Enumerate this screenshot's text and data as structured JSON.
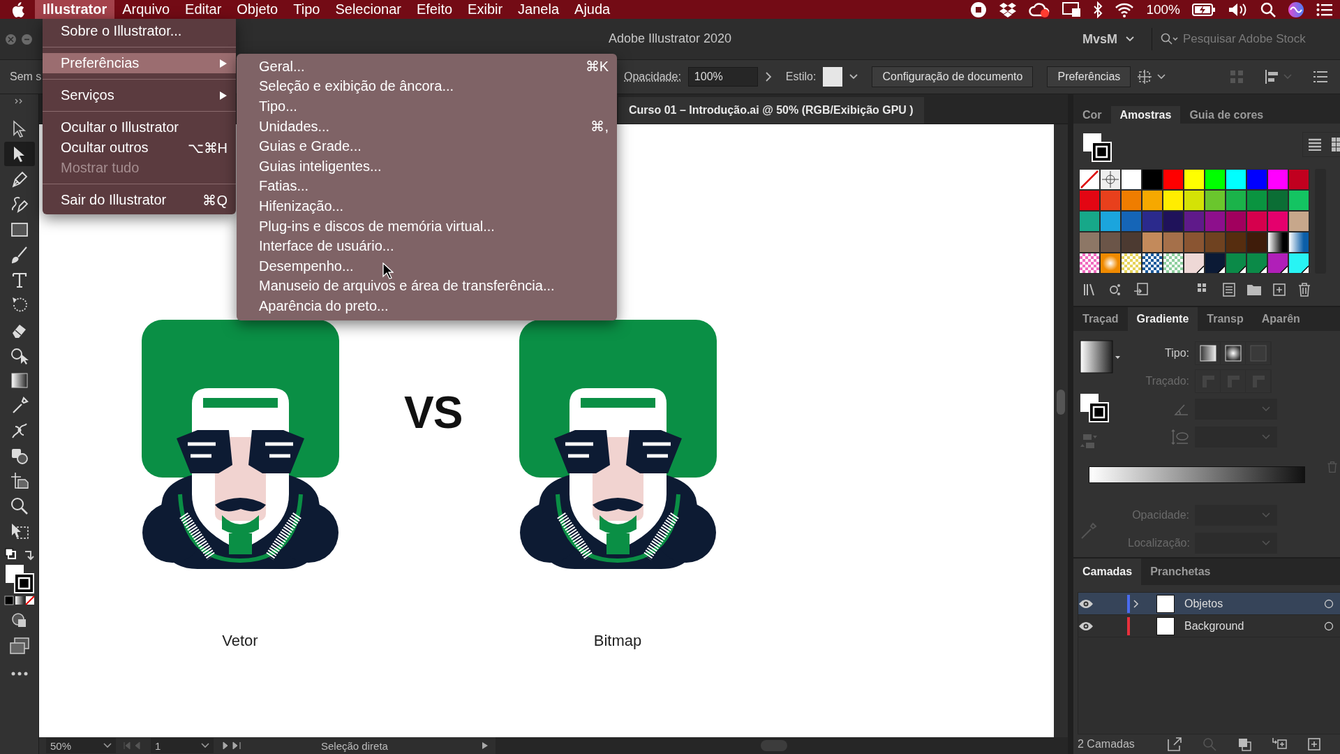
{
  "menubar": {
    "menus": [
      {
        "label": "Illustrator",
        "selected": true
      },
      {
        "label": "Arquivo",
        "selected": false
      },
      {
        "label": "Editar",
        "selected": false
      },
      {
        "label": "Objeto",
        "selected": false
      },
      {
        "label": "Tipo",
        "selected": false
      },
      {
        "label": "Selecionar",
        "selected": false
      },
      {
        "label": "Efeito",
        "selected": false
      },
      {
        "label": "Exibir",
        "selected": false
      },
      {
        "label": "Janela",
        "selected": false
      },
      {
        "label": "Ajuda",
        "selected": false
      }
    ],
    "battery": "100%"
  },
  "app_menu": {
    "groups": [
      [
        {
          "label": "Sobre o Illustrator...",
          "selected": false,
          "disabled": false,
          "submenu": false
        }
      ],
      [
        {
          "label": "Preferências",
          "selected": true,
          "disabled": false,
          "submenu": true
        }
      ],
      [
        {
          "label": "Serviços",
          "selected": false,
          "disabled": false,
          "submenu": true
        }
      ],
      [
        {
          "label": "Ocultar o Illustrator",
          "selected": false,
          "disabled": false,
          "submenu": false
        },
        {
          "label": "Ocultar outros",
          "shortcut": "⌥⌘H",
          "selected": false,
          "disabled": false,
          "submenu": false
        },
        {
          "label": "Mostrar tudo",
          "selected": false,
          "disabled": true,
          "submenu": false
        }
      ],
      [
        {
          "label": "Sair do Illustrator",
          "shortcut": "⌘Q",
          "selected": false,
          "disabled": false,
          "submenu": false
        }
      ]
    ]
  },
  "submenu": {
    "items": [
      {
        "label": "Geral...",
        "shortcut": "⌘K"
      },
      {
        "label": "Seleção e exibição de âncora..."
      },
      {
        "label": "Tipo..."
      },
      {
        "label": "Unidades...",
        "shortcut": "⌘,"
      },
      {
        "label": "Guias e Grade..."
      },
      {
        "label": "Guias inteligentes..."
      },
      {
        "label": "Fatias..."
      },
      {
        "label": "Hifenização..."
      },
      {
        "label": "Plug-ins e discos de memória virtual..."
      },
      {
        "label": "Interface de usuário..."
      },
      {
        "label": "Desempenho..."
      },
      {
        "label": "Manuseio de arquivos e área de transferência..."
      },
      {
        "label": "Aparência do preto..."
      }
    ]
  },
  "title_bar": {
    "title": "Adobe Illustrator 2020",
    "workspace": "MvsM",
    "search": {
      "placeholder": "Pesquisar Adobe Stock"
    }
  },
  "control_bar": {
    "left_text": "Sem s",
    "opacity_label": "Opacidade:",
    "opacity_value": "100%",
    "style_label": "Estilo:",
    "buttons": [
      "Configuração de documento",
      "Preferências"
    ]
  },
  "document_tab": {
    "title": "Curso 01 – Introdução.ai @ 50% (RGB/Exibição GPU )"
  },
  "toolbar": {
    "tools": [
      {
        "selected": false
      },
      {
        "selected": true
      },
      {
        "selected": false
      },
      {
        "selected": false
      },
      {
        "selected": false
      },
      {
        "selected": false
      },
      {
        "selected": false
      },
      {
        "selected": false
      },
      {
        "selected": false
      },
      {
        "selected": false
      },
      {
        "selected": false
      },
      {
        "selected": false
      },
      {
        "selected": false
      },
      {
        "selected": false
      },
      {
        "selected": false
      },
      {
        "selected": false
      },
      {
        "selected": false
      }
    ]
  },
  "canvas": {
    "vs_text": "VS",
    "captions": [
      "Vetor",
      "Bitmap"
    ]
  },
  "swatches_panel": {
    "tabs": [
      {
        "label": "Cor",
        "selected": false
      },
      {
        "label": "Amostras",
        "selected": true
      },
      {
        "label": "Guia de cores",
        "selected": false
      }
    ],
    "swatches": [
      {
        "kind": "none"
      },
      {
        "kind": "registration"
      },
      {
        "kind": "process",
        "color": "#ffffff"
      },
      {
        "kind": "process",
        "color": "#000000"
      },
      {
        "kind": "process",
        "color": "#ff0000"
      },
      {
        "kind": "process",
        "color": "#ffff00"
      },
      {
        "kind": "process",
        "color": "#00ff00"
      },
      {
        "kind": "process",
        "color": "#00ffff"
      },
      {
        "kind": "process",
        "color": "#0000ff"
      },
      {
        "kind": "process",
        "color": "#ff00ff"
      },
      {
        "kind": "process",
        "color": "#c1001f"
      },
      {
        "kind": "process",
        "color": "#e30613"
      },
      {
        "kind": "process",
        "color": "#e8401c"
      },
      {
        "kind": "process",
        "color": "#ef7d00"
      },
      {
        "kind": "process",
        "color": "#f6a800"
      },
      {
        "kind": "process",
        "color": "#ffed00"
      },
      {
        "kind": "process",
        "color": "#d4e206"
      },
      {
        "kind": "process",
        "color": "#6ac62d"
      },
      {
        "kind": "process",
        "color": "#1bb34a"
      },
      {
        "kind": "process",
        "color": "#0a9440"
      },
      {
        "kind": "process",
        "color": "#0b6e35"
      },
      {
        "kind": "process",
        "color": "#14c462"
      },
      {
        "kind": "process",
        "color": "#17a889"
      },
      {
        "kind": "process",
        "color": "#1ba5dd"
      },
      {
        "kind": "process",
        "color": "#1565b7"
      },
      {
        "kind": "process",
        "color": "#2b2a8c"
      },
      {
        "kind": "process",
        "color": "#1f125a"
      },
      {
        "kind": "process",
        "color": "#5f1a8a"
      },
      {
        "kind": "process",
        "color": "#8d0f8c"
      },
      {
        "kind": "process",
        "color": "#a1005e"
      },
      {
        "kind": "process",
        "color": "#d6004d"
      },
      {
        "kind": "process",
        "color": "#e5006d"
      },
      {
        "kind": "process",
        "color": "#c7a78b"
      },
      {
        "kind": "process",
        "color": "#8d7766"
      },
      {
        "kind": "process",
        "color": "#6b5548"
      },
      {
        "kind": "process",
        "color": "#4c3a31"
      },
      {
        "kind": "process",
        "color": "#c38a5b"
      },
      {
        "kind": "process",
        "color": "#a5704a"
      },
      {
        "kind": "process",
        "color": "#8a5532"
      },
      {
        "kind": "process",
        "color": "#6f4220"
      },
      {
        "kind": "process",
        "color": "#562d0f"
      },
      {
        "kind": "process",
        "color": "#3f1c0a"
      },
      {
        "kind": "gradient",
        "color": "#000000"
      },
      {
        "kind": "gradient",
        "color": "#0b5ea8"
      },
      {
        "kind": "pattern",
        "color": "#f06bbf"
      },
      {
        "kind": "radial",
        "color": "#f08a00"
      },
      {
        "kind": "pattern",
        "color": "#e6d35a"
      },
      {
        "kind": "pattern",
        "color": "#1d5b9c"
      },
      {
        "kind": "pattern",
        "color": "#8fcf9f"
      },
      {
        "kind": "global",
        "color": "#eed8d6"
      },
      {
        "kind": "global",
        "color": "#0b1a35"
      },
      {
        "kind": "global",
        "color": "#0b8a48"
      },
      {
        "kind": "global",
        "color": "#0b8a48"
      },
      {
        "kind": "global",
        "color": "#b01fb8"
      },
      {
        "kind": "global",
        "color": "#28f4f4"
      }
    ]
  },
  "gradient_panel": {
    "tabs": [
      {
        "label": "Traçad",
        "selected": false
      },
      {
        "label": "Gradiente",
        "selected": true
      },
      {
        "label": "Transp",
        "selected": false
      },
      {
        "label": "Aparên",
        "selected": false
      }
    ],
    "type": {
      "label": "Tipo:",
      "disabled": false
    },
    "stroke": {
      "label": "Traçado:",
      "disabled": true
    },
    "opacity": {
      "label": "Opacidade:",
      "disabled": true
    },
    "location": {
      "label": "Localização:",
      "disabled": true
    }
  },
  "layers_panel": {
    "tabs": [
      {
        "label": "Camadas",
        "selected": true
      },
      {
        "label": "Pranchetas",
        "selected": false
      }
    ],
    "layers": [
      {
        "name": "Objetos",
        "color": "#4a6cf0",
        "selected": true,
        "expandable": true,
        "visible": true
      },
      {
        "name": "Background",
        "color": "#e8303c",
        "selected": false,
        "expandable": false,
        "visible": true
      }
    ],
    "footer": "2 Camadas"
  },
  "status_bar": {
    "zoom": "50%",
    "artboard": "1",
    "tool": "Seleção direta"
  }
}
